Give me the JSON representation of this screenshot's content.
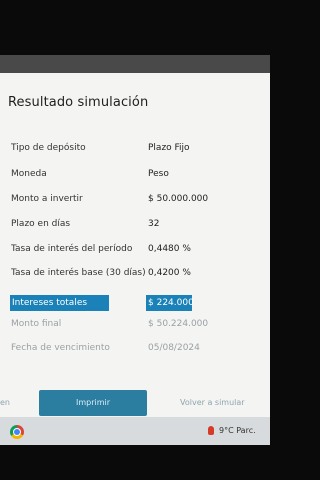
{
  "page": {
    "title": "Resultado simulación"
  },
  "rows": [
    {
      "label": "Tipo de depósito",
      "value": "Plazo Fijo"
    },
    {
      "label": "Moneda",
      "value": "Peso"
    },
    {
      "label": "Monto a invertir",
      "value": "$ 50.000.000"
    },
    {
      "label": "Plazo en días",
      "value": "32"
    },
    {
      "label": "Tasa de interés del período",
      "value": "0,4480 %"
    },
    {
      "label": "Tasa de interés base (30 días)",
      "value": "0,4200 %"
    },
    {
      "label": "Intereses totales",
      "value": "$ 224.000"
    },
    {
      "label": "Monto final",
      "value": "$ 50.224.000"
    },
    {
      "label": "Fecha de vencimiento",
      "value": "05/08/2024"
    }
  ],
  "actions": {
    "print_label": "Imprimir",
    "back_label": "Volver a simular",
    "edge_label": "en"
  },
  "taskbar": {
    "weather": "9°C  Parc."
  },
  "colors": {
    "accent": "#1a82b8",
    "button": "#2c7ea1"
  },
  "icons": [
    "chrome-icon",
    "weather-icon"
  ]
}
